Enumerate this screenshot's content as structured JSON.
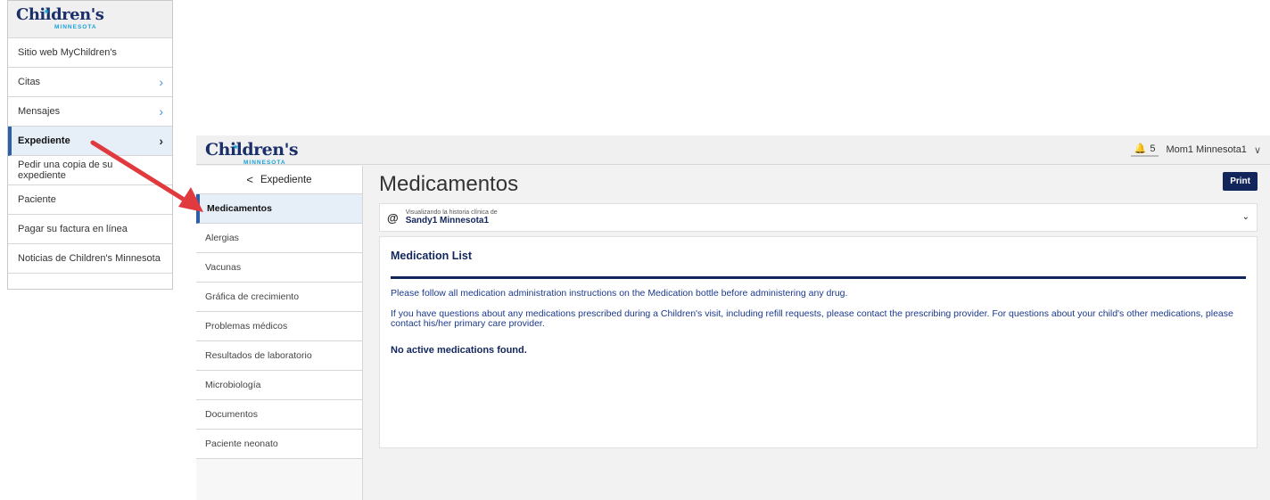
{
  "brand": {
    "logo_text": "Children's",
    "logo_sub": "MINNESOTA",
    "star": "★"
  },
  "menu": {
    "items": [
      {
        "label": "Sitio web MyChildren's",
        "chevron": ""
      },
      {
        "label": "Citas",
        "chevron": "›"
      },
      {
        "label": "Mensajes",
        "chevron": "›"
      },
      {
        "label": "Expediente",
        "chevron": "›"
      },
      {
        "label": "Pedir una copia de su expediente",
        "chevron": ""
      },
      {
        "label": "Paciente",
        "chevron": ""
      },
      {
        "label": "Pagar su factura en línea",
        "chevron": ""
      },
      {
        "label": "Noticias de Children's Minnesota",
        "chevron": ""
      }
    ]
  },
  "header": {
    "notification_count": "5",
    "bell_icon": "🔔",
    "user_name": "Mom1 Minnesota1",
    "user_chevron": "∨"
  },
  "sidebar": {
    "back_chevron": "<",
    "back_label": "Expediente",
    "items": [
      "Medicamentos",
      "Alergias",
      "Vacunas",
      "Gráfica de crecimiento",
      "Problemas médicos",
      "Resultados de laboratorio",
      "Microbiología",
      "Documentos",
      "Paciente neonato"
    ]
  },
  "main": {
    "title": "Medicamentos",
    "print_label": "Print",
    "patient_label": "Visualizando la historia clínica de",
    "patient_name": "Sandy1 Minnesota1",
    "at_icon": "@",
    "patient_chevron": "⌄"
  },
  "card": {
    "title": "Medication List",
    "p1": "Please follow all medication administration instructions on the Medication bottle before administering any drug.",
    "p2": "If you have questions about any medications prescribed during a Children's visit, including refill requests, please contact the prescribing provider. For questions about your child's other medications, please contact his/her primary care provider.",
    "empty": "No active medications found."
  },
  "colors": {
    "navy": "#13265c",
    "accent": "#2c5fa8",
    "arrow": "#e0393e",
    "logo_blue": "#19a1d9"
  }
}
